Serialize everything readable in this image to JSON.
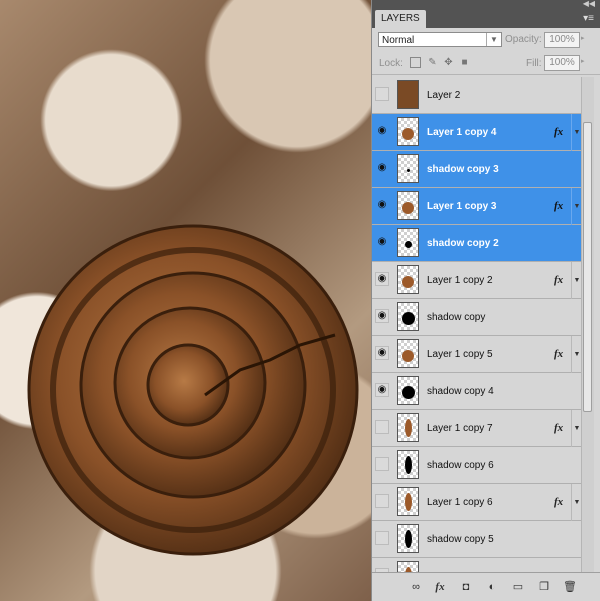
{
  "panel": {
    "tab_label": "LAYERS",
    "blend_mode": "Normal",
    "opacity_label": "Opacity:",
    "opacity_value": "100%",
    "lock_label": "Lock:",
    "fill_label": "Fill:",
    "fill_value": "100%"
  },
  "layers": [
    {
      "name": "Layer 2",
      "visible": false,
      "selected": false,
      "fx": false,
      "thumb": "full"
    },
    {
      "name": "Layer 1 copy 4",
      "visible": true,
      "selected": true,
      "fx": true,
      "thumb": "ring"
    },
    {
      "name": "shadow copy 3",
      "visible": true,
      "selected": true,
      "fx": false,
      "thumb": "dot-small"
    },
    {
      "name": "Layer 1 copy 3",
      "visible": true,
      "selected": true,
      "fx": true,
      "thumb": "ring"
    },
    {
      "name": "shadow copy 2",
      "visible": true,
      "selected": true,
      "fx": false,
      "thumb": "dot"
    },
    {
      "name": "Layer 1 copy 2",
      "visible": true,
      "selected": false,
      "fx": true,
      "thumb": "ring"
    },
    {
      "name": "shadow copy",
      "visible": true,
      "selected": false,
      "fx": false,
      "thumb": "dot-large"
    },
    {
      "name": "Layer 1 copy 5",
      "visible": true,
      "selected": false,
      "fx": true,
      "thumb": "ring"
    },
    {
      "name": "shadow copy 4",
      "visible": true,
      "selected": false,
      "fx": false,
      "thumb": "dot-large"
    },
    {
      "name": "Layer 1 copy 7",
      "visible": false,
      "selected": false,
      "fx": true,
      "thumb": "leaf"
    },
    {
      "name": "shadow copy 6",
      "visible": false,
      "selected": false,
      "fx": false,
      "thumb": "leaf-dark"
    },
    {
      "name": "Layer 1 copy 6",
      "visible": false,
      "selected": false,
      "fx": true,
      "thumb": "leaf"
    },
    {
      "name": "shadow copy 5",
      "visible": false,
      "selected": false,
      "fx": false,
      "thumb": "leaf-dark"
    },
    {
      "name": "",
      "visible": false,
      "selected": false,
      "fx": false,
      "thumb": "leaf"
    }
  ],
  "fx_label": "fx",
  "icons": {
    "eye": "eye-icon",
    "link": "link-layers-icon",
    "fx": "add-layer-style-icon",
    "mask": "add-mask-icon",
    "adjust": "adjustment-layer-icon",
    "group": "new-group-icon",
    "newlayer": "new-layer-icon",
    "trash": "delete-layer-icon"
  },
  "colors": {
    "selection": "#3f91e8",
    "panel": "#d6d6d6",
    "tabbar": "#535353"
  }
}
